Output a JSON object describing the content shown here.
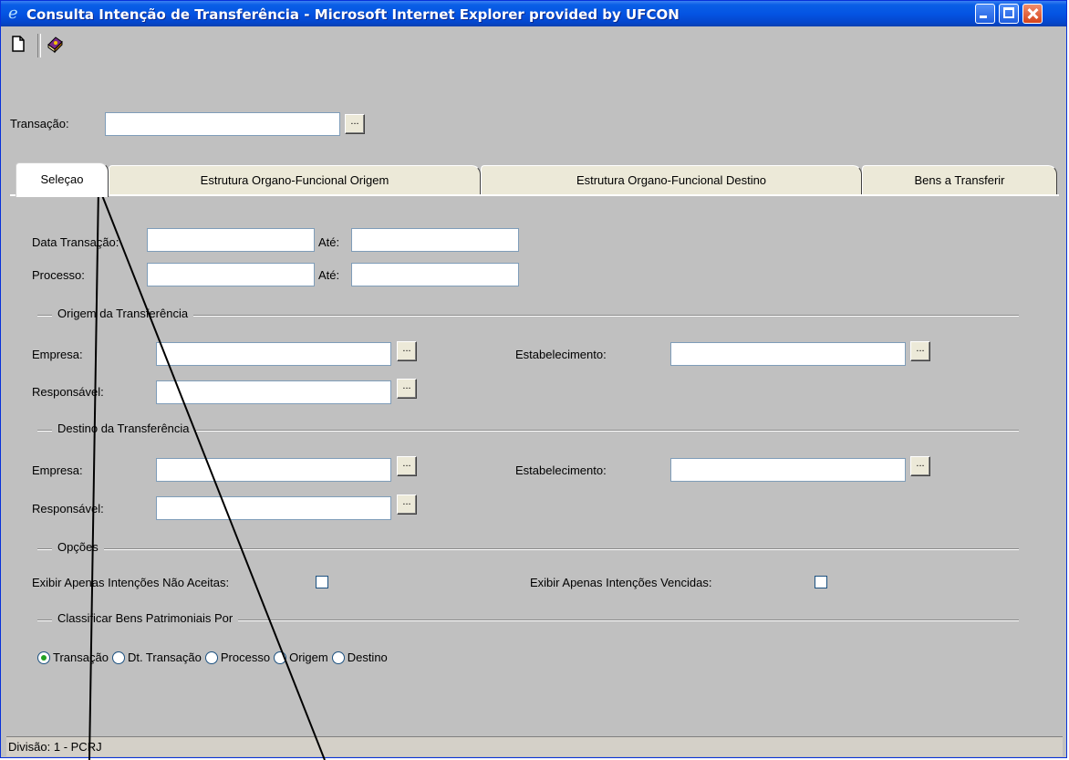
{
  "window": {
    "title": "Consulta Intenção de Transferência - Microsoft Internet Explorer provided by UFCON",
    "title_icon": "e"
  },
  "toolbar": {
    "icons": [
      "new-document-icon",
      "book-icon"
    ]
  },
  "transacao": {
    "label": "Transação:",
    "value": "",
    "lookup_label": "..."
  },
  "tabs": [
    {
      "label": "Seleçao",
      "active": true
    },
    {
      "label": "Estrutura Organo-Funcional Origem",
      "active": false
    },
    {
      "label": "Estrutura Organo-Funcional Destino",
      "active": false
    },
    {
      "label": "Bens a Transferir",
      "active": false
    }
  ],
  "selecao": {
    "data_transacao_label": "Data Transação:",
    "processo_label": "Processo:",
    "ate_label": "Até:",
    "data_transacao_de": "",
    "data_transacao_ate": "",
    "processo_de": "",
    "processo_ate": ""
  },
  "origem": {
    "group_label": "Origem da Transferência",
    "empresa_label": "Empresa:",
    "responsavel_label": "Responsável:",
    "estabelecimento_label": "Estabelecimento:",
    "empresa": "",
    "responsavel": "",
    "estabelecimento": ""
  },
  "destino": {
    "group_label": "Destino da Transferência",
    "empresa_label": "Empresa:",
    "responsavel_label": "Responsável:",
    "estabelecimento_label": "Estabelecimento:",
    "empresa": "",
    "responsavel": "",
    "estabelecimento": ""
  },
  "opcoes": {
    "group_label": "Opções",
    "nao_aceitas_label": "Exibir Apenas Intenções Não Aceitas:",
    "nao_aceitas_checked": false,
    "vencidas_label": "Exibir Apenas Intenções Vencidas:",
    "vencidas_checked": false
  },
  "classificar": {
    "group_label": "Classificar Bens Patrimoniais Por",
    "options": [
      "Transação",
      "Dt. Transação",
      "Processo",
      "Origem",
      "Destino"
    ],
    "selected": "Transação"
  },
  "lookup_label": "...",
  "status": {
    "text": "Divisão: 1 - PCRJ"
  }
}
